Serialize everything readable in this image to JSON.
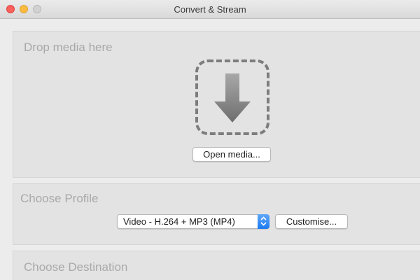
{
  "window": {
    "title": "Convert & Stream"
  },
  "drop_section": {
    "title": "Drop media here",
    "drop_icon": "download-arrow-icon",
    "open_media_label": "Open media..."
  },
  "profile_section": {
    "title": "Choose Profile",
    "selected_profile": "Video - H.264 + MP3 (MP4)",
    "customise_label": "Customise..."
  },
  "destination_section": {
    "title": "Choose Destination"
  },
  "colors": {
    "accent": "#1b79f2",
    "close": "#fc605c",
    "minimize": "#fdbc40",
    "zoom_disabled": "#d2d2d2"
  }
}
